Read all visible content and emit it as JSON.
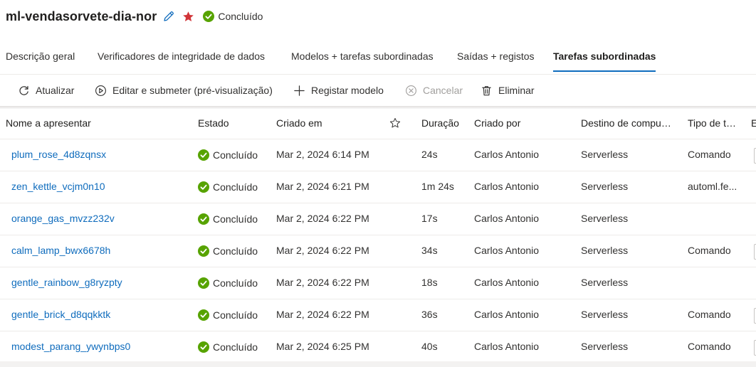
{
  "header": {
    "title": "ml-vendasorvete-dia-nor",
    "status": "Concluído"
  },
  "colors": {
    "accent": "#0f6cbd",
    "success": "#57a300",
    "favorite": "#d13438",
    "disabled": "#a19f9d"
  },
  "tabs": [
    {
      "label": "Descrição geral",
      "active": false
    },
    {
      "label": "Verificadores de integridade de dados",
      "active": false
    },
    {
      "label": "Modelos + tarefas subordinadas",
      "active": false
    },
    {
      "label": "Saídas + registos",
      "active": false
    },
    {
      "label": "Tarefas subordinadas",
      "active": true
    }
  ],
  "toolbar": {
    "refresh": "Atualizar",
    "edit_submit": "Editar e submeter (pré-visualização)",
    "register_model": "Registar modelo",
    "cancel": "Cancelar",
    "delete": "Eliminar"
  },
  "table": {
    "columns": {
      "name": "Nome a apresentar",
      "status": "Estado",
      "created": "Criado em",
      "duration": "Duração",
      "created_by": "Criado por",
      "compute": "Destino de compu…",
      "type": "Tipo de t…",
      "extra": "E"
    },
    "rows": [
      {
        "name": "plum_rose_4d8zqnsx",
        "status": "Concluído",
        "created": "Mar 2, 2024 6:14 PM",
        "duration": "24s",
        "created_by": "Carlos Antonio",
        "compute": "Serverless",
        "type": "Comando"
      },
      {
        "name": "zen_kettle_vcjm0n10",
        "status": "Concluído",
        "created": "Mar 2, 2024 6:21 PM",
        "duration": "1m 24s",
        "created_by": "Carlos Antonio",
        "compute": "Serverless",
        "type": "automl.fe..."
      },
      {
        "name": "orange_gas_mvzz232v",
        "status": "Concluído",
        "created": "Mar 2, 2024 6:22 PM",
        "duration": "17s",
        "created_by": "Carlos Antonio",
        "compute": "Serverless",
        "type": ""
      },
      {
        "name": "calm_lamp_bwx6678h",
        "status": "Concluído",
        "created": "Mar 2, 2024 6:22 PM",
        "duration": "34s",
        "created_by": "Carlos Antonio",
        "compute": "Serverless",
        "type": "Comando"
      },
      {
        "name": "gentle_rainbow_g8ryzpty",
        "status": "Concluído",
        "created": "Mar 2, 2024 6:22 PM",
        "duration": "18s",
        "created_by": "Carlos Antonio",
        "compute": "Serverless",
        "type": ""
      },
      {
        "name": "gentle_brick_d8qqkktk",
        "status": "Concluído",
        "created": "Mar 2, 2024 6:22 PM",
        "duration": "36s",
        "created_by": "Carlos Antonio",
        "compute": "Serverless",
        "type": "Comando"
      },
      {
        "name": "modest_parang_ywynbps0",
        "status": "Concluído",
        "created": "Mar 2, 2024 6:25 PM",
        "duration": "40s",
        "created_by": "Carlos Antonio",
        "compute": "Serverless",
        "type": "Comando"
      }
    ]
  }
}
